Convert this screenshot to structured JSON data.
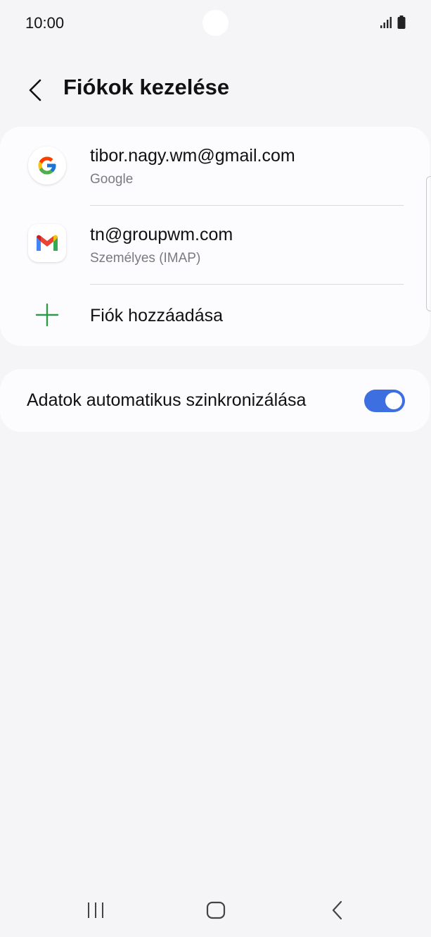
{
  "status_bar": {
    "time": "10:00"
  },
  "header": {
    "title": "Fiókok kezelése"
  },
  "accounts": [
    {
      "email": "tibor.nagy.wm@gmail.com",
      "type": "Google",
      "icon": "google-icon"
    },
    {
      "email": "tn@groupwm.com",
      "type": "Személyes (IMAP)",
      "icon": "gmail-icon"
    }
  ],
  "add_account": {
    "label": "Fiók hozzáadása",
    "icon": "plus-icon"
  },
  "sync": {
    "label": "Adatok automatikus szinkronizálása",
    "enabled": true
  },
  "colors": {
    "accent": "#3e6fe0",
    "plus_green": "#2f9a4c",
    "background": "#f5f5f8",
    "card": "#fcfcfe"
  },
  "nav_icons": [
    "recent-apps-icon",
    "home-icon",
    "back-icon"
  ]
}
